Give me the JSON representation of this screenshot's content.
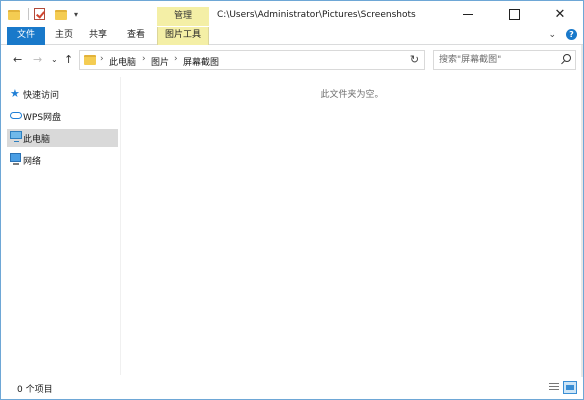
{
  "window": {
    "title_path": "C:\\Users\\Administrator\\Pictures\\Screenshots",
    "context_tab_group": "管理"
  },
  "ribbon": {
    "tabs": [
      {
        "label": "文件",
        "active": true
      },
      {
        "label": "主页"
      },
      {
        "label": "共享"
      },
      {
        "label": "查看"
      },
      {
        "label": "图片工具",
        "contextual": true
      }
    ]
  },
  "address_bar": {
    "crumbs": [
      "此电脑",
      "图片",
      "屏幕截图"
    ]
  },
  "search": {
    "placeholder": "搜索\"屏幕截图\""
  },
  "nav_pane": {
    "items": [
      {
        "label": "快速访问",
        "icon": "star-icon"
      },
      {
        "label": "WPS网盘",
        "icon": "cloud-icon"
      },
      {
        "label": "此电脑",
        "icon": "computer-icon",
        "selected": true
      },
      {
        "label": "网络",
        "icon": "network-icon"
      }
    ]
  },
  "content": {
    "empty_message": "此文件夹为空。"
  },
  "status": {
    "item_count": "0 个项目"
  },
  "colors": {
    "file_tab": "#1979ca",
    "context_tab": "#f4efa6",
    "selection": "#d9d9d9"
  }
}
